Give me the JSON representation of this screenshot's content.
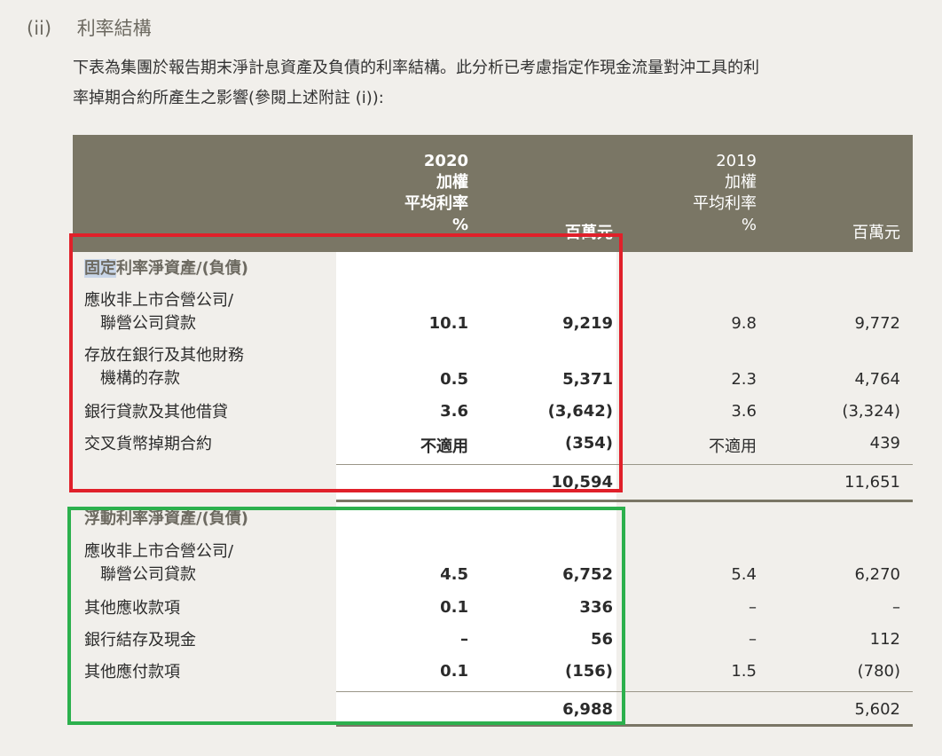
{
  "section": {
    "number": "(ii)",
    "title": "利率結構"
  },
  "intro": {
    "line1": "下表為集團於報告期末淨計息資產及負債的利率結構。此分析已考慮指定作現金流量對沖工具的利",
    "line2": "率掉期合約所產生之影響(參閱上述附註 (i)):"
  },
  "header": {
    "y2020": "2020",
    "y2019": "2019",
    "weighted": "加權",
    "avg_rate": "平均利率",
    "pct": "%",
    "unit": "百萬元"
  },
  "fixed": {
    "title_selected": "固定",
    "title_rest": "利率淨資產/(負債)",
    "rows": [
      {
        "label1": "應收非上市合營公司/",
        "label2": "聯營公司貸款",
        "r2020": "10.1",
        "v2020": "9,219",
        "r2019": "9.8",
        "v2019": "9,772"
      },
      {
        "label1": "存放在銀行及其他財務",
        "label2": "機構的存款",
        "r2020": "0.5",
        "v2020": "5,371",
        "r2019": "2.3",
        "v2019": "4,764"
      },
      {
        "label1": "銀行貸款及其他借貸",
        "label2": "",
        "r2020": "3.6",
        "v2020": "(3,642)",
        "r2019": "3.6",
        "v2019": "(3,324)"
      },
      {
        "label1": "交叉貨幣掉期合約",
        "label2": "",
        "r2020": "不適用",
        "v2020": "(354)",
        "r2019": "不適用",
        "v2019": "439"
      }
    ],
    "total2020": "10,594",
    "total2019": "11,651"
  },
  "floating": {
    "title": "浮動利率淨資產/(負債)",
    "rows": [
      {
        "label1": "應收非上市合營公司/",
        "label2": "聯營公司貸款",
        "r2020": "4.5",
        "v2020": "6,752",
        "r2019": "5.4",
        "v2019": "6,270"
      },
      {
        "label1": "其他應收款項",
        "label2": "",
        "r2020": "0.1",
        "v2020": "336",
        "r2019": "–",
        "v2019": "–"
      },
      {
        "label1": "銀行結存及現金",
        "label2": "",
        "r2020": "–",
        "v2020": "56",
        "r2019": "–",
        "v2019": "112"
      },
      {
        "label1": "其他應付款項",
        "label2": "",
        "r2020": "0.1",
        "v2020": "(156)",
        "r2019": "1.5",
        "v2019": "(780)"
      }
    ],
    "total2020": "6,988",
    "total2019": "5,602"
  },
  "colors": {
    "header_bg": "#7a7665",
    "page_bg": "#f1efeb",
    "highlight_red": "#e0202a",
    "highlight_green": "#2cb04d"
  }
}
